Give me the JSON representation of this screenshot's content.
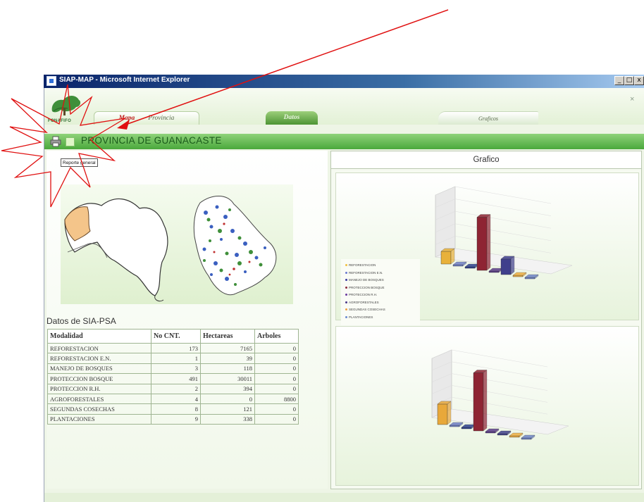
{
  "window": {
    "title": "SIAP-MAP - Microsoft Internet Explorer",
    "controls": {
      "minimize": "_",
      "maximize": "□",
      "close": "x"
    }
  },
  "header": {
    "logo_text": "FONAFIFO",
    "close_glyph": "×",
    "tabs": {
      "mapa_label_1": "Mapa",
      "mapa_label_2": "Provincia",
      "datos_label": "Datos",
      "graficos_label": "Graficos"
    }
  },
  "toolbar": {
    "province_title": "PROVINCIA DE GUANACASTE",
    "print_icon": "printer-icon",
    "report_button": "Reporte general"
  },
  "datos": {
    "section_title": "Datos de SIA-PSA",
    "columns": [
      "Modalidad",
      "No CNT.",
      "Hectareas",
      "Arboles"
    ],
    "rows": [
      [
        "REFORESTACION",
        "173",
        "7165",
        "0"
      ],
      [
        "REFORESTACION E.N.",
        "1",
        "39",
        "0"
      ],
      [
        "MANEJO DE BOSQUES",
        "3",
        "118",
        "0"
      ],
      [
        "PROTECCION BOSQUE",
        "491",
        "30011",
        "0"
      ],
      [
        "PROTECCION R.H.",
        "2",
        "394",
        "0"
      ],
      [
        "AGROFORESTALES",
        "4",
        "0",
        "8800"
      ],
      [
        "SEGUNDAS COSECHAS",
        "8",
        "121",
        "0"
      ],
      [
        "PLANTACIONES",
        "9",
        "338",
        "0"
      ]
    ]
  },
  "grafico": {
    "header": "Grafico",
    "legend": [
      {
        "label": "REFORESTACION",
        "color": "#f0c040"
      },
      {
        "label": "REFORESTACION E.N.",
        "color": "#6a7bd0"
      },
      {
        "label": "MANEJO DE BOSQUES",
        "color": "#3a3aa0"
      },
      {
        "label": "PROTECCION BOSQUE",
        "color": "#8b2a3a"
      },
      {
        "label": "PROTECCION R.H.",
        "color": "#6a3aa0"
      },
      {
        "label": "AGROFORESTALES",
        "color": "#4a3a8a"
      },
      {
        "label": "SEGUNDAS COSECHAS",
        "color": "#f0a040"
      },
      {
        "label": "PLANTACIONES",
        "color": "#6a8ad0"
      }
    ]
  },
  "chart_data": [
    {
      "type": "bar",
      "categories": [
        "REFORESTACION",
        "REFORESTACION E.N.",
        "MANEJO DE BOSQUES",
        "PROTECCION BOSQUE",
        "PROTECCION R.H.",
        "AGROFORESTALES",
        "SEGUNDAS COSECHAS",
        "PLANTACIONES"
      ],
      "values": [
        7165,
        39,
        118,
        30011,
        394,
        8800,
        121,
        338
      ],
      "colors": [
        "#e8b13a",
        "#6f7fc8",
        "#2e3f8f",
        "#8e2433",
        "#5a3a8a",
        "#3f3f8c",
        "#f0b040",
        "#6e85c8"
      ],
      "ylim": [
        0,
        35000
      ],
      "legend": "left"
    },
    {
      "type": "bar",
      "categories": [
        "REFORESTACION",
        "REFORESTACION E.N.",
        "MANEJO DE BOSQUES",
        "PROTECCION BOSQUE",
        "PROTECCION R.H.",
        "AGROFORESTALES",
        "SEGUNDAS COSECHAS",
        "PLANTACIONES"
      ],
      "values": [
        173,
        1,
        3,
        491,
        2,
        4,
        8,
        9
      ],
      "colors": [
        "#e8a83a",
        "#6f7fc8",
        "#2e3f8f",
        "#8e2433",
        "#5a3a8a",
        "#3f3f8c",
        "#f0b040",
        "#6e85c8"
      ],
      "ylim": [
        0,
        500
      ]
    }
  ]
}
